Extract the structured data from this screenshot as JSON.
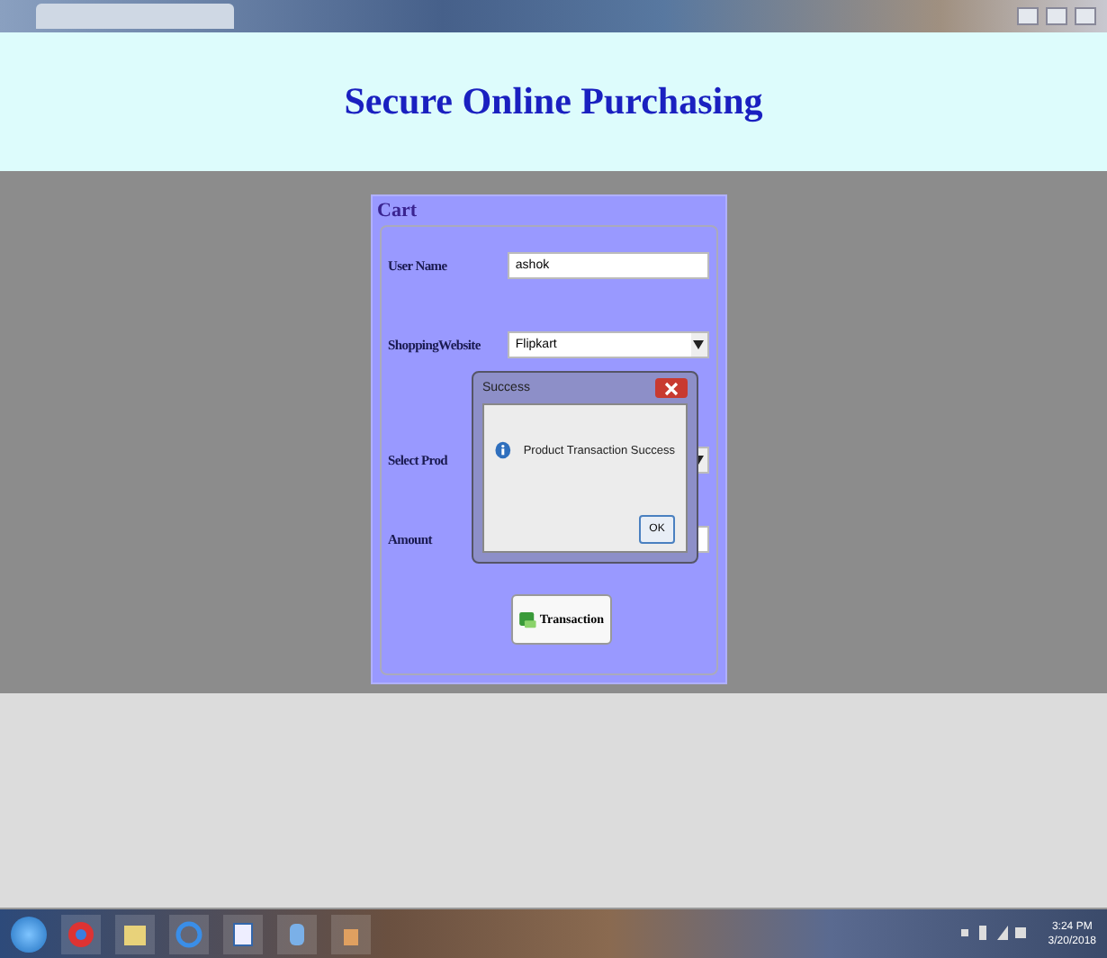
{
  "header": {
    "title": "Secure Online Purchasing"
  },
  "cart": {
    "title": "Cart",
    "fields": [
      {
        "kind": "text",
        "label": "User Name",
        "value": "ashok"
      },
      {
        "kind": "select",
        "label": "ShoppingWebsite",
        "value": "Flipkart"
      },
      {
        "kind": "select",
        "label": "Select Prod"
      },
      {
        "kind": "text",
        "label": "Amount"
      }
    ],
    "button": "Transaction"
  },
  "dialog": {
    "title": "Success",
    "message": "Product Transaction Success",
    "button": "OK"
  },
  "taskbar": {
    "time": "3:24 PM",
    "date": "3/20/2018"
  }
}
